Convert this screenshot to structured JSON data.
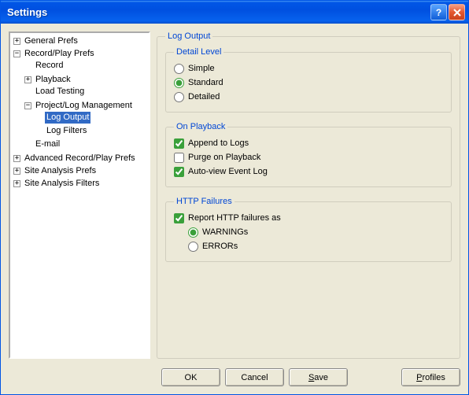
{
  "window": {
    "title": "Settings"
  },
  "tree": {
    "general_prefs": "General Prefs",
    "record_play_prefs": "Record/Play Prefs",
    "record": "Record",
    "playback": "Playback",
    "load_testing": "Load Testing",
    "proj_log_mgmt": "Project/Log Management",
    "log_output": "Log Output",
    "log_filters": "Log Filters",
    "email": "E-mail",
    "adv_record_play": "Advanced Record/Play Prefs",
    "site_analysis_prefs": "Site Analysis Prefs",
    "site_analysis_filters": "Site Analysis Filters"
  },
  "panel": {
    "title": "Log Output",
    "detail_level": {
      "legend": "Detail Level",
      "simple": "Simple",
      "standard": "Standard",
      "detailed": "Detailed",
      "selected": "standard"
    },
    "on_playback": {
      "legend": "On Playback",
      "append": {
        "label": "Append to Logs",
        "checked": true
      },
      "purge": {
        "label": "Purge on Playback",
        "checked": false
      },
      "autoview": {
        "label": "Auto-view Event Log",
        "checked": true
      }
    },
    "http_failures": {
      "legend": "HTTP Failures",
      "report": {
        "label": "Report HTTP failures as",
        "checked": true
      },
      "warnings": "WARNINGs",
      "errors": "ERRORs",
      "selected": "warnings"
    }
  },
  "buttons": {
    "ok": "OK",
    "cancel": "Cancel",
    "save": "Save",
    "profiles": "Profiles"
  }
}
